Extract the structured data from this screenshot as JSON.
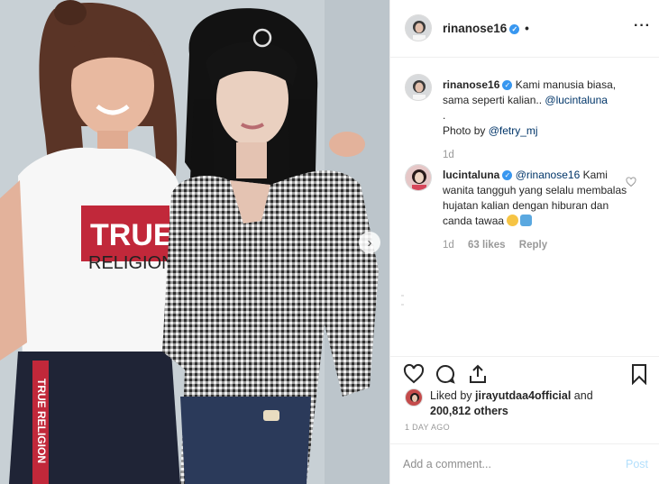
{
  "post": {
    "username": "rinanose16",
    "header_dot": "•",
    "verified_mark": "✓",
    "more_icon": "···",
    "photo": {
      "shirt_left_text_top": "TRUE",
      "shirt_left_text_bottom": "RELIGION",
      "pants_stripe_text": "TRUE RELIGION"
    }
  },
  "caption": {
    "username": "rinanose16",
    "text": "Kami manusia biasa, sama seperti kalian.. ",
    "mention": "@lucintaluna",
    "separator": ".",
    "photo_by_prefix": "Photo by ",
    "photo_by_mention": "@fetry_mj",
    "age": "1d"
  },
  "comment": {
    "username": "lucintaluna",
    "mention": "@rinanose16",
    "text": " Kami wanita tangguh yang selalu membalas hujatan kalian dengan hiburan dan canda tawaa ",
    "age": "1d",
    "likes": "63 likes",
    "reply_label": "Reply"
  },
  "likes": {
    "prefix": "Liked by ",
    "user": "jirayutdaa4official",
    "middle": " and",
    "count": "200,812 others"
  },
  "timestamp": "1 DAY AGO",
  "add_comment": {
    "placeholder": "Add a comment...",
    "post_label": "Post"
  },
  "colors": {
    "link": "#003569",
    "verified": "#3897f0",
    "post_disabled": "#b2dffc",
    "muted": "#999999"
  }
}
